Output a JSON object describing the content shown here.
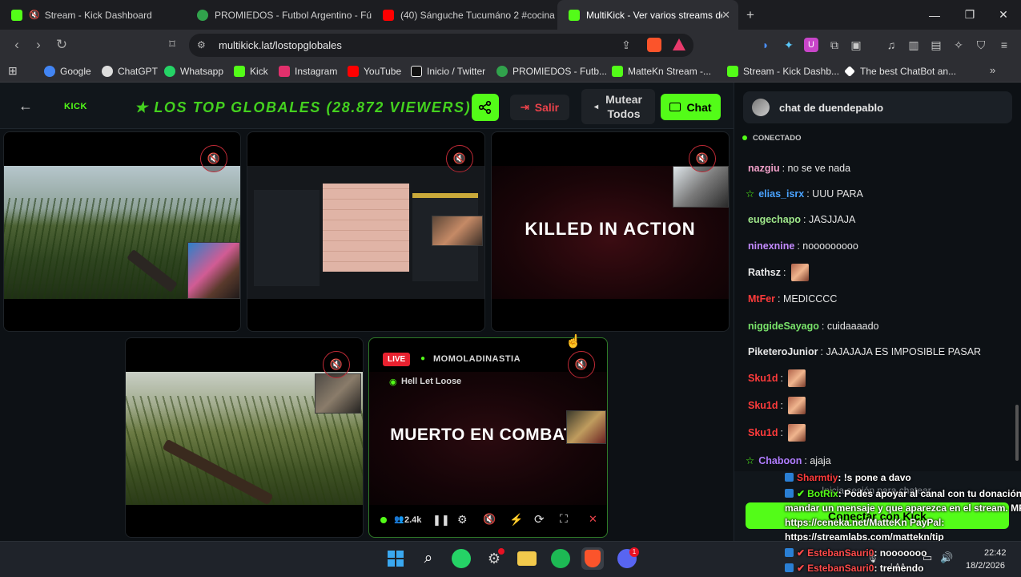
{
  "browser": {
    "tabs": [
      {
        "title": "Stream - Kick Dashboard",
        "favicon_color": "#53fc18"
      },
      {
        "title": "PROMIEDOS - Futbol Argentino - Fút",
        "favicon_color": "#31a24c"
      },
      {
        "title": "(40) Sánguche Tucumáno 2 #cocina #",
        "favicon_color": "#ff0000"
      },
      {
        "title": "MultiKick - Ver varios streams de",
        "favicon_color": "#53fc18"
      }
    ],
    "new_tab": "+",
    "url": "multikick.lat/lostopglobales",
    "bookmarks": [
      {
        "label": "Google",
        "color": "#4285f4"
      },
      {
        "label": "ChatGPT",
        "color": "#dddddd"
      },
      {
        "label": "Whatsapp",
        "color": "#25d366"
      },
      {
        "label": "Kick",
        "color": "#53fc18"
      },
      {
        "label": "Instagram",
        "color": "#e1306c"
      },
      {
        "label": "YouTube",
        "color": "#ff0000"
      },
      {
        "label": "Inicio / Twitter",
        "color": "#ffffff"
      },
      {
        "label": "PROMIEDOS - Futb...",
        "color": "#31a24c"
      },
      {
        "label": "MatteKn Stream -...",
        "color": "#53fc18"
      },
      {
        "label": "Stream - Kick Dashb...",
        "color": "#53fc18"
      },
      {
        "label": "The best ChatBot an...",
        "color": "#ffffff"
      }
    ]
  },
  "app": {
    "logo": "KICK",
    "title": "★ LOS TOP GLOBALES (28.872 VIEWERS) ★",
    "exit_label": "Salir",
    "mute_all_label_1": "Mutear",
    "mute_all_label_2": "Todos",
    "chat_label": "Chat",
    "accent": "#53fc18"
  },
  "streams": {
    "tile1": {
      "overlay": ""
    },
    "tile3": {
      "overlay": "KILLED IN ACTION"
    },
    "tile5": {
      "live_badge": "LIVE",
      "channel": "MOMOLADINASTIA",
      "game": "Hell Let Loose",
      "overlay": "MUERTO EN COMBATE",
      "viewers": "2.4k"
    }
  },
  "chat": {
    "header": "chat de duendepablo",
    "status": "CONECTADO",
    "messages": [
      {
        "user": "nazgiu",
        "color": "#f0a0c8",
        "text": "no se ve nada",
        "badge": false,
        "emote": false
      },
      {
        "user": "elias_isrx",
        "color": "#4aa3ff",
        "text": "UUU PARA",
        "badge": true,
        "emote": false
      },
      {
        "user": "eugechapo",
        "color": "#9fe88a",
        "text": "JASJJAJA",
        "badge": false,
        "emote": false
      },
      {
        "user": "ninexnine",
        "color": "#c48bff",
        "text": "nooooooooo",
        "badge": false,
        "emote": false
      },
      {
        "user": "Rathsz",
        "color": "#e8e8e8",
        "text": "",
        "badge": false,
        "emote": true
      },
      {
        "user": "MtFer",
        "color": "#ff3b3b",
        "text": "MEDICCCC",
        "badge": false,
        "emote": false
      },
      {
        "user": "niggideSayago",
        "color": "#79e36a",
        "text": "cuidaaaado",
        "badge": false,
        "emote": false
      },
      {
        "user": "PiketeroJunior",
        "color": "#e8e8e8",
        "text": "JAJAJAJA ES IMPOSIBLE PASAR",
        "badge": false,
        "emote": false
      },
      {
        "user": "Sku1d",
        "color": "#ff3b3b",
        "text": "",
        "badge": false,
        "emote": true
      },
      {
        "user": "Sku1d",
        "color": "#ff3b3b",
        "text": "",
        "badge": false,
        "emote": true
      },
      {
        "user": "Sku1d",
        "color": "#ff3b3b",
        "text": "",
        "badge": false,
        "emote": true
      },
      {
        "user": "Chaboon",
        "color": "#b07cff",
        "text": "ajaja",
        "badge": true,
        "emote": false
      }
    ],
    "login_hint": "Inicia sesión para chatear",
    "connect_label": "Conectar con Kick"
  },
  "overlay_chat": [
    {
      "user": "Sharmtiy",
      "color": "#ff3b3b",
      "text": ": !s pone a davo"
    },
    {
      "user": "BotRix",
      "color": "#53fc18",
      "text": ": Podes apoyar al canal con tu donación,"
    },
    {
      "user": "",
      "color": "#ffffff",
      "text": "mandar un mensaje y que aparezca en el stream. MP:"
    },
    {
      "user": "",
      "color": "#ffffff",
      "text": "https://ceneka.net/MatteKn PayPal:"
    },
    {
      "user": "",
      "color": "#ffffff",
      "text": "https://streamlabs.com/mattekn/tip"
    },
    {
      "user": "EstebanSauri0",
      "color": "#ff4a4a",
      "text": ": nooooooo"
    },
    {
      "user": "EstebanSauri0",
      "color": "#ff4a4a",
      "text": ": tremendo"
    }
  ],
  "taskbar": {
    "lang": "LAA",
    "time": "22:42",
    "date": "18/2/2026"
  }
}
